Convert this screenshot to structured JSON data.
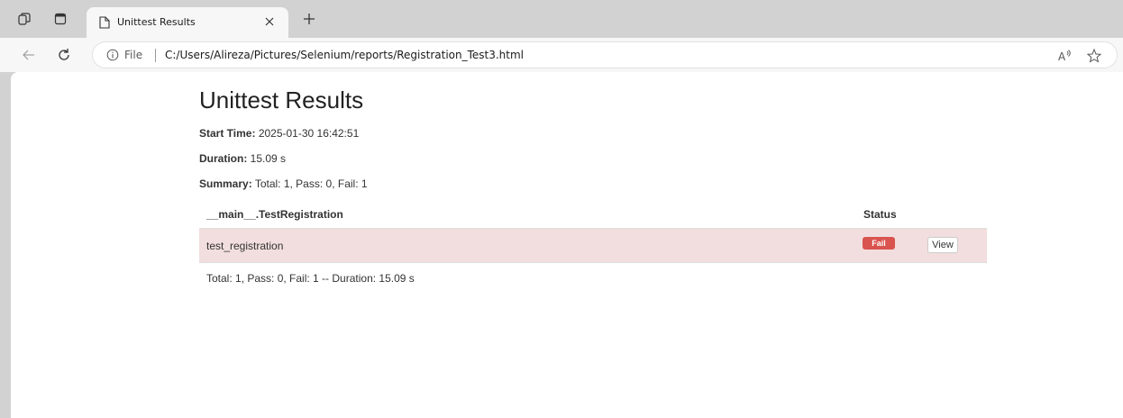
{
  "browser": {
    "tab_title": "Unittest Results",
    "address_scheme_label": "File",
    "url": "C:/Users/Alireza/Pictures/Selenium/reports/Registration_Test3.html",
    "icons": [
      "workspaces-icon",
      "tab-actions-icon",
      "page-icon",
      "close-icon",
      "new-tab-icon",
      "back-icon",
      "reload-icon",
      "info-icon",
      "read-aloud-icon",
      "favorite-star-icon"
    ]
  },
  "report": {
    "title": "Unittest Results",
    "start_time_label": "Start Time:",
    "start_time_value": "2025-01-30 16:42:51",
    "duration_label": "Duration:",
    "duration_value": "15.09 s",
    "summary_label": "Summary:",
    "summary_value": "Total: 1, Pass: 0, Fail: 1",
    "table": {
      "header_name": "__main__.TestRegistration",
      "header_status": "Status",
      "rows": [
        {
          "name": "test_registration",
          "status": "Fail",
          "action": "View"
        }
      ]
    },
    "footer": "Total: 1, Pass: 0, Fail: 1 -- Duration: 15.09 s"
  },
  "colors": {
    "fail_row_bg": "#f2dede",
    "fail_badge": "#d9534f"
  }
}
